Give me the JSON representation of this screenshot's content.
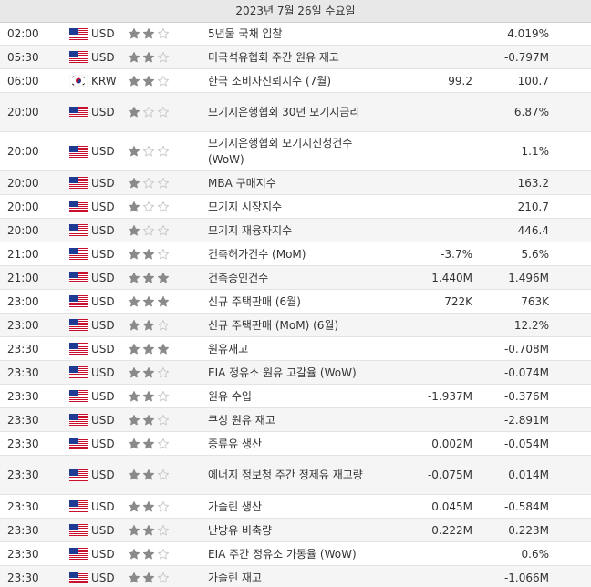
{
  "header": {
    "date": "2023년 7월 26일 수요일"
  },
  "colors": {
    "star_on": "#8a8a8a",
    "star_off": "#c9c9c9"
  },
  "rows": [
    {
      "time": "02:00",
      "flag": "us",
      "currency": "USD",
      "importance": 2,
      "event": "5년물 국채 입찰",
      "actual": "",
      "previous": "4.019%"
    },
    {
      "time": "05:30",
      "flag": "us",
      "currency": "USD",
      "importance": 2,
      "event": "미국석유협회 주간 원유 재고",
      "actual": "",
      "previous": "-0.797M"
    },
    {
      "time": "06:00",
      "flag": "kr",
      "currency": "KRW",
      "importance": 2,
      "event": "한국 소비자신뢰지수 (7월)",
      "actual": "99.2",
      "previous": "100.7"
    },
    {
      "time": "20:00",
      "flag": "us",
      "currency": "USD",
      "importance": 1,
      "event": "모기지은행협회 30년 모기지금리",
      "actual": "",
      "previous": "6.87%"
    },
    {
      "time": "20:00",
      "flag": "us",
      "currency": "USD",
      "importance": 1,
      "event": "모기지은행협회 모기지신청건수 (WoW)",
      "actual": "",
      "previous": "1.1%"
    },
    {
      "time": "20:00",
      "flag": "us",
      "currency": "USD",
      "importance": 1,
      "event": "MBA 구매지수",
      "actual": "",
      "previous": "163.2"
    },
    {
      "time": "20:00",
      "flag": "us",
      "currency": "USD",
      "importance": 1,
      "event": "모기지 시장지수",
      "actual": "",
      "previous": "210.7"
    },
    {
      "time": "20:00",
      "flag": "us",
      "currency": "USD",
      "importance": 1,
      "event": "모기지 재융자지수",
      "actual": "",
      "previous": "446.4"
    },
    {
      "time": "21:00",
      "flag": "us",
      "currency": "USD",
      "importance": 2,
      "event": "건축허가건수 (MoM)",
      "actual": "-3.7%",
      "previous": "5.6%"
    },
    {
      "time": "21:00",
      "flag": "us",
      "currency": "USD",
      "importance": 3,
      "event": "건축승인건수",
      "actual": "1.440M",
      "previous": "1.496M"
    },
    {
      "time": "23:00",
      "flag": "us",
      "currency": "USD",
      "importance": 3,
      "event": "신규 주택판매 (6월)",
      "actual": "722K",
      "previous": "763K"
    },
    {
      "time": "23:00",
      "flag": "us",
      "currency": "USD",
      "importance": 2,
      "event": "신규 주택판매 (MoM) (6월)",
      "actual": "",
      "previous": "12.2%"
    },
    {
      "time": "23:30",
      "flag": "us",
      "currency": "USD",
      "importance": 3,
      "event": "원유재고",
      "actual": "",
      "previous": "-0.708M"
    },
    {
      "time": "23:30",
      "flag": "us",
      "currency": "USD",
      "importance": 2,
      "event": "EIA 정유소 원유 고갈율 (WoW)",
      "actual": "",
      "previous": "-0.074M"
    },
    {
      "time": "23:30",
      "flag": "us",
      "currency": "USD",
      "importance": 2,
      "event": "원유 수입",
      "actual": "-1.937M",
      "previous": "-0.376M"
    },
    {
      "time": "23:30",
      "flag": "us",
      "currency": "USD",
      "importance": 2,
      "event": "쿠싱 원유 재고",
      "actual": "",
      "previous": "-2.891M"
    },
    {
      "time": "23:30",
      "flag": "us",
      "currency": "USD",
      "importance": 2,
      "event": "증류유 생산",
      "actual": "0.002M",
      "previous": "-0.054M"
    },
    {
      "time": "23:30",
      "flag": "us",
      "currency": "USD",
      "importance": 2,
      "event": "에너지 정보청 주간 정제유 재고량",
      "actual": "-0.075M",
      "previous": "0.014M"
    },
    {
      "time": "23:30",
      "flag": "us",
      "currency": "USD",
      "importance": 2,
      "event": "가솔린 생산",
      "actual": "0.045M",
      "previous": "-0.584M"
    },
    {
      "time": "23:30",
      "flag": "us",
      "currency": "USD",
      "importance": 2,
      "event": "난방유 비축량",
      "actual": "0.222M",
      "previous": "0.223M"
    },
    {
      "time": "23:30",
      "flag": "us",
      "currency": "USD",
      "importance": 2,
      "event": "EIA 주간 정유소 가동율 (WoW)",
      "actual": "",
      "previous": "0.6%"
    },
    {
      "time": "23:30",
      "flag": "us",
      "currency": "USD",
      "importance": 2,
      "event": "가솔린 재고",
      "actual": "",
      "previous": "-1.066M"
    }
  ]
}
